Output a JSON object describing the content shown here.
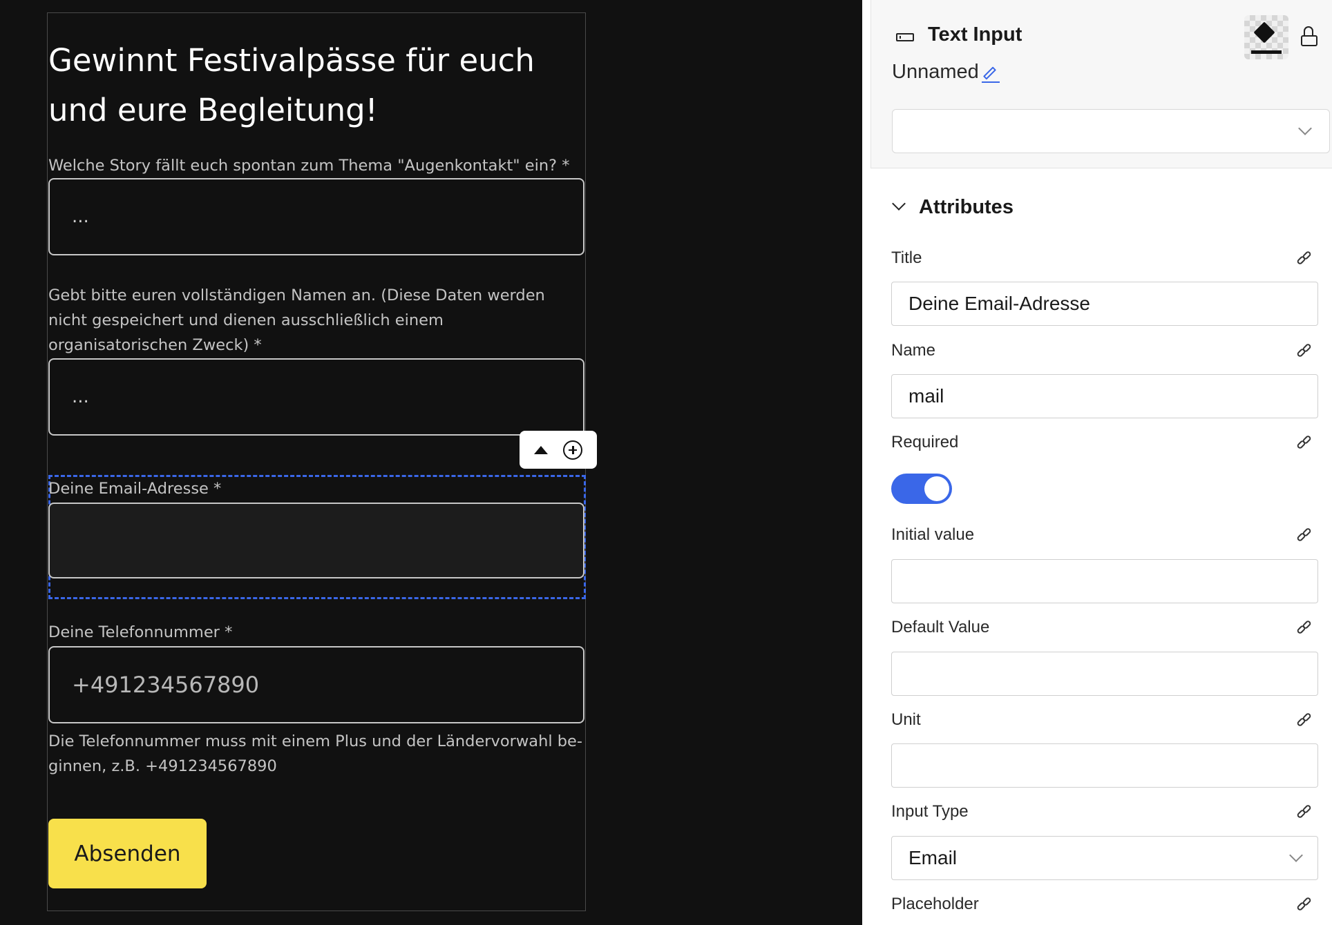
{
  "form": {
    "title": "Gewinnt Festivalpässe für euch und eure Begleitung!",
    "q1_label": "Welche Story fällt euch spontan zum Thema \"Augenkontakt\" ein? *",
    "q1_placeholder": "...",
    "q2_label": "Gebt bitte euren vollständigen Namen an. (Diese Daten werden nicht gespeichert und dienen ausschließlich einem organisatorischen Zweck) *",
    "q2_placeholder": "...",
    "email_label": "Deine Email-Adresse *",
    "email_value": "",
    "phone_label": "Deine Telefonnummer *",
    "phone_placeholder": "+491234567890",
    "phone_help": "Die Telefonnummer muss mit einem Plus und der Ländervorwahl be-ginnen, z.B. +491234567890",
    "submit_label": "Absenden"
  },
  "panel": {
    "component_type": "Text Input",
    "component_name": "Unnamed",
    "variant_value": "",
    "section_title": "Attributes",
    "fields": {
      "title_label": "Title",
      "title_value": "Deine Email-Adresse",
      "name_label": "Name",
      "name_value": "mail",
      "required_label": "Required",
      "required_value": true,
      "initial_label": "Initial value",
      "initial_value": "",
      "default_label": "Default Value",
      "default_value": "",
      "unit_label": "Unit",
      "unit_value": "",
      "input_type_label": "Input Type",
      "input_type_value": "Email",
      "placeholder_label": "Placeholder"
    }
  },
  "colors": {
    "canvas_bg": "#111111",
    "selection": "#3a67e8",
    "submit_bg": "#f8e04b",
    "toggle_on": "#3a67e8"
  },
  "icons": [
    "text-input-icon",
    "paint-bucket-icon",
    "lock-open-icon",
    "pencil-icon",
    "chevron-down-icon",
    "link-icon",
    "arrow-up-icon",
    "plus-circle-icon"
  ]
}
